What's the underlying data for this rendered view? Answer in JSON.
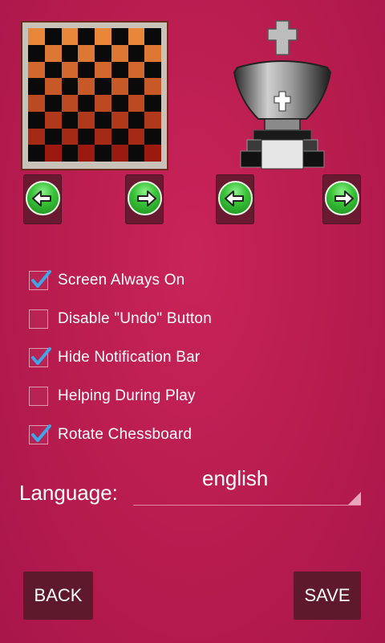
{
  "board_preview": {
    "colors": {
      "light": "#e8873a",
      "dark": "#0a0a0a",
      "bottom_tint": "#9a1a10"
    }
  },
  "king_preview": {
    "icon": "chess-king-icon"
  },
  "nav_arrows": [
    {
      "icon": "arrow-left-icon",
      "target": "board"
    },
    {
      "icon": "arrow-right-icon",
      "target": "board"
    },
    {
      "icon": "arrow-left-icon",
      "target": "pieces"
    },
    {
      "icon": "arrow-right-icon",
      "target": "pieces"
    }
  ],
  "options": [
    {
      "label": "Screen Always On",
      "checked": true
    },
    {
      "label": "Disable \"Undo\" Button",
      "checked": false
    },
    {
      "label": "Hide Notification Bar",
      "checked": true
    },
    {
      "label": "Helping During Play",
      "checked": false
    },
    {
      "label": "Rotate Chessboard",
      "checked": true
    }
  ],
  "language": {
    "label": "Language:",
    "value": "english"
  },
  "buttons": {
    "back": "BACK",
    "save": "SAVE"
  },
  "colors": {
    "background": "#b81c4f",
    "button_bg": "#5e1a2c",
    "check": "#3ea6e8"
  }
}
